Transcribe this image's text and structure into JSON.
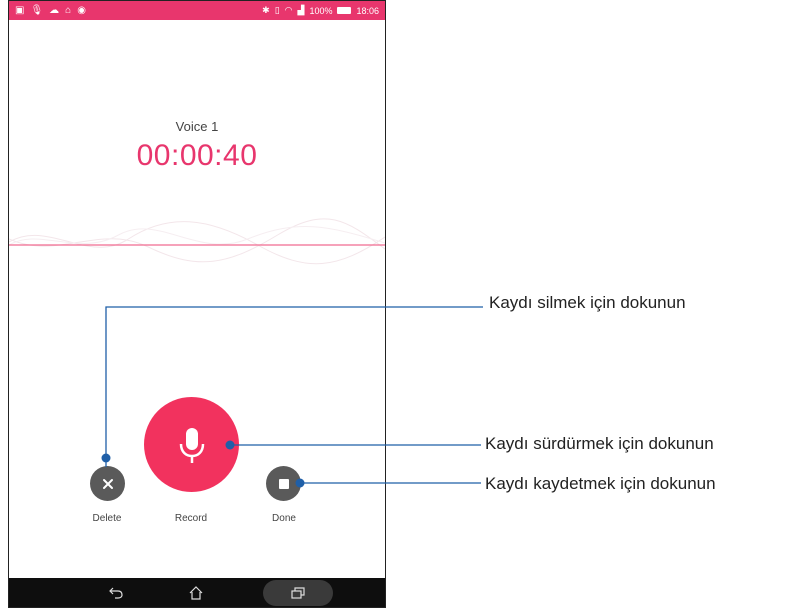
{
  "statusbar": {
    "left_icons": [
      "image-icon",
      "mic-icon",
      "cloud-icon",
      "lock-icon",
      "app-icon"
    ],
    "battery": "100%",
    "time": "18:06"
  },
  "recording": {
    "title": "Voice 1",
    "timer": "00:00:40"
  },
  "controls": {
    "delete_label": "Delete",
    "record_label": "Record",
    "done_label": "Done"
  },
  "callouts": {
    "delete": "Kaydı silmek için dokunun",
    "resume": "Kaydı sürdürmek için dokunun",
    "save": "Kaydı kaydetmek için dokunun"
  },
  "colors": {
    "accent": "#e8366d",
    "record_button": "#f2325e",
    "callout_line": "#1f5fa8",
    "side_button": "#5a5a5a"
  }
}
